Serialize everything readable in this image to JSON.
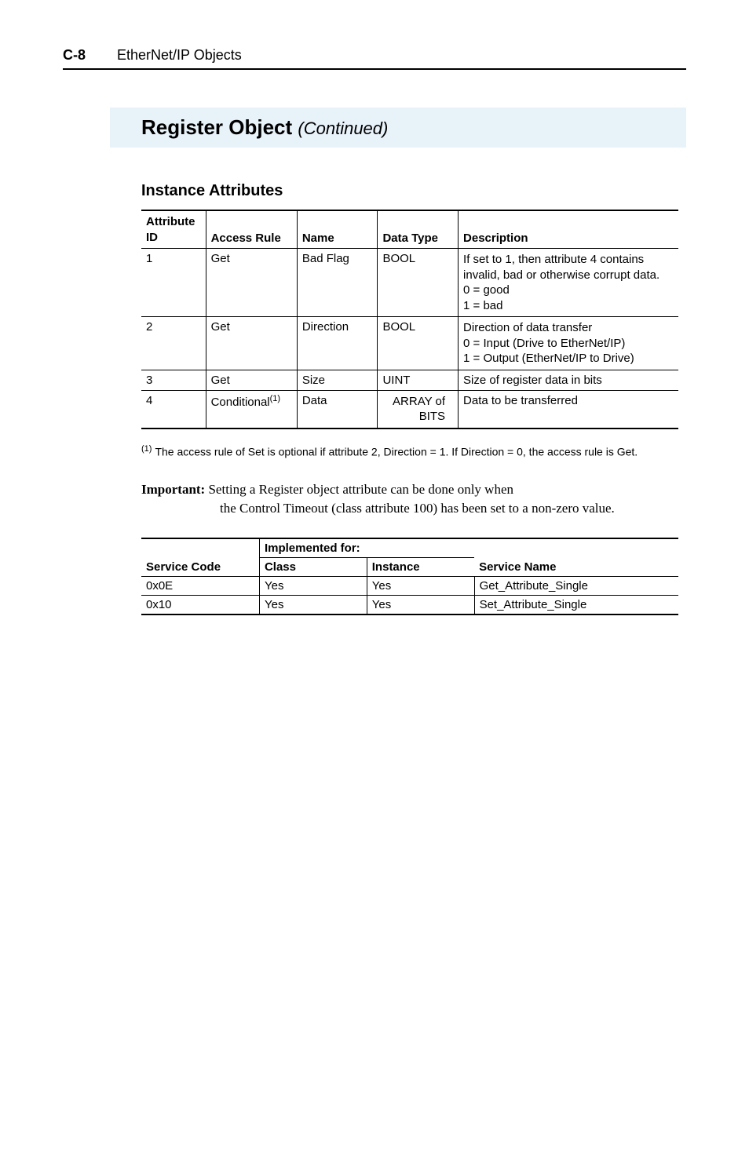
{
  "header": {
    "page_number": "C-8",
    "title": "EtherNet/IP Objects"
  },
  "section": {
    "title": "Register Object",
    "continued": "(Continued)"
  },
  "instance_attributes": {
    "heading": "Instance Attributes",
    "columns": {
      "attr_id": "Attribute\nID",
      "access_rule": "Access Rule",
      "name": "Name",
      "data_type": "Data Type",
      "description": "Description"
    },
    "rows": [
      {
        "attr_id": "1",
        "access_rule": "Get",
        "name": "Bad Flag",
        "data_type": "BOOL",
        "description": "If set to 1, then attribute 4 contains invalid, bad or otherwise corrupt data.\n0 = good\n1 = bad"
      },
      {
        "attr_id": "2",
        "access_rule": "Get",
        "name": "Direction",
        "data_type": "BOOL",
        "description": "Direction of data transfer\n0 = Input (Drive to EtherNet/IP)\n1 = Output (EtherNet/IP to Drive)"
      },
      {
        "attr_id": "3",
        "access_rule": "Get",
        "name": "Size",
        "data_type": "UINT",
        "description": "Size of register data in bits"
      },
      {
        "attr_id": "4",
        "access_rule": "Conditional",
        "access_rule_sup": "(1)",
        "name": "Data",
        "data_type": "ARRAY of\nBITS",
        "description": "Data to be transferred"
      }
    ]
  },
  "footnote": {
    "marker": "(1)",
    "text": "The access rule of Set is optional if attribute 2, Direction = 1. If Direction = 0, the access rule is Get."
  },
  "important": {
    "label": "Important:",
    "first_line": "Setting a Register object attribute can be done only when",
    "rest": "the Control Timeout (class attribute 100) has been set to a non-zero value."
  },
  "services": {
    "implemented_for": "Implemented for:",
    "columns": {
      "service_code": "Service Code",
      "class": "Class",
      "instance": "Instance",
      "service_name": "Service Name"
    },
    "rows": [
      {
        "service_code": "0x0E",
        "class": "Yes",
        "instance": "Yes",
        "service_name": "Get_Attribute_Single"
      },
      {
        "service_code": "0x10",
        "class": "Yes",
        "instance": "Yes",
        "service_name": "Set_Attribute_Single"
      }
    ]
  }
}
